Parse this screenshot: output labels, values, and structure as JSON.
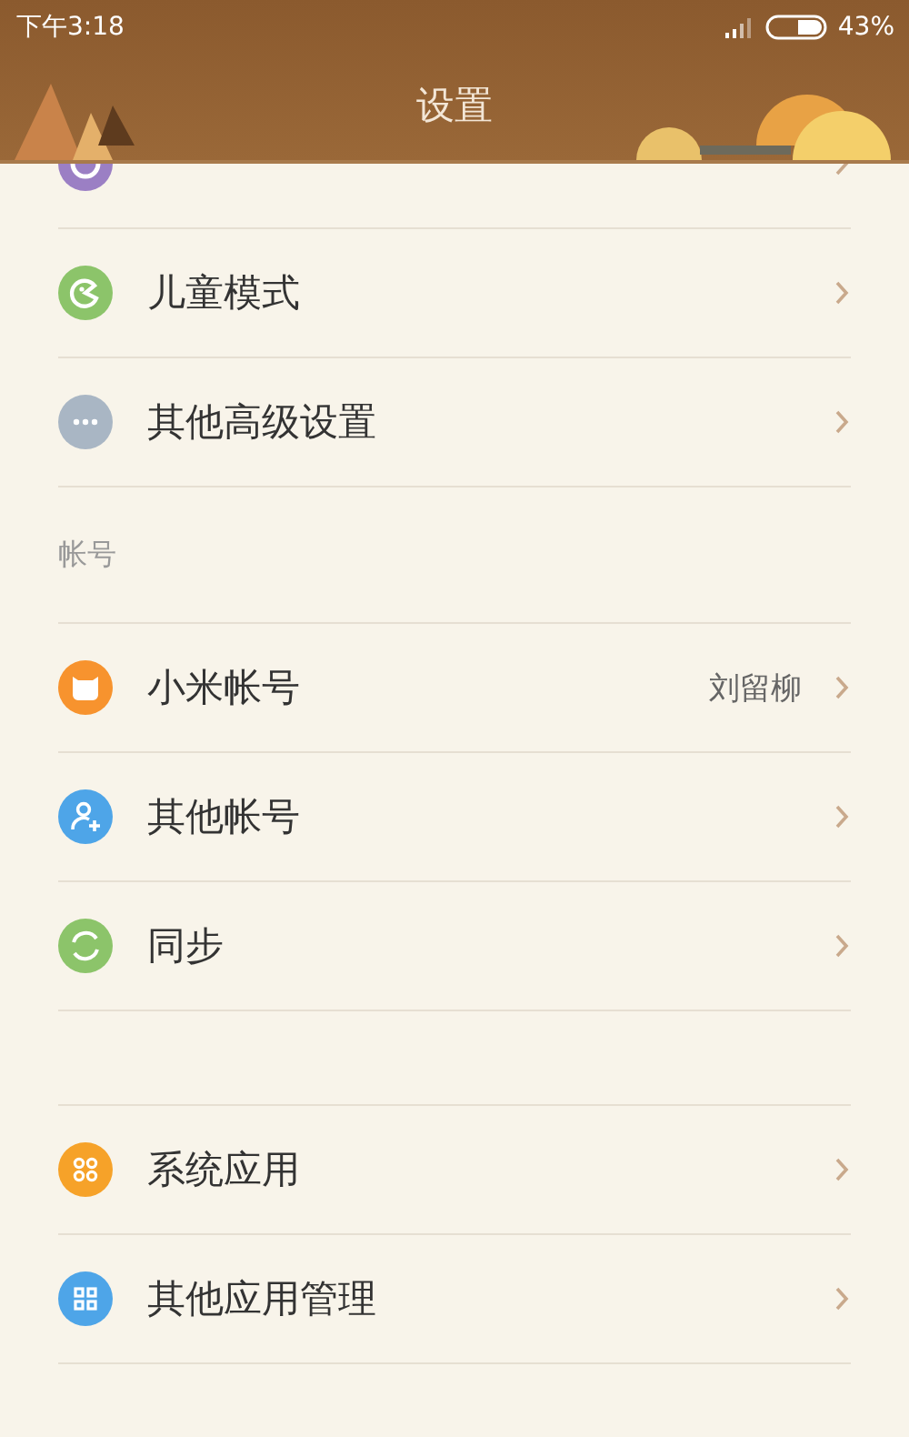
{
  "status_bar": {
    "time": "下午3:18",
    "battery": "43%"
  },
  "header": {
    "title": "设置"
  },
  "sections": [
    {
      "items": [
        {
          "kind": "moon",
          "cut": true,
          "color": "#9b7fc4"
        },
        {
          "label": "儿童模式",
          "kind": "kid",
          "color": "#8cc46a"
        },
        {
          "label": "其他高级设置",
          "kind": "more",
          "color": "#a9b6c4"
        }
      ]
    },
    {
      "title": "帐号",
      "items": [
        {
          "label": "小米帐号",
          "value": "刘留柳",
          "kind": "mi",
          "color": "#f7932e"
        },
        {
          "label": "其他帐号",
          "kind": "user-add",
          "color": "#4ea5e8"
        },
        {
          "label": "同步",
          "kind": "sync",
          "color": "#8cc46a"
        }
      ]
    },
    {
      "items": [
        {
          "label": "系统应用",
          "kind": "rings",
          "color": "#f6a229"
        },
        {
          "label": "其他应用管理",
          "kind": "grid",
          "color": "#4ea5e8"
        }
      ]
    }
  ]
}
